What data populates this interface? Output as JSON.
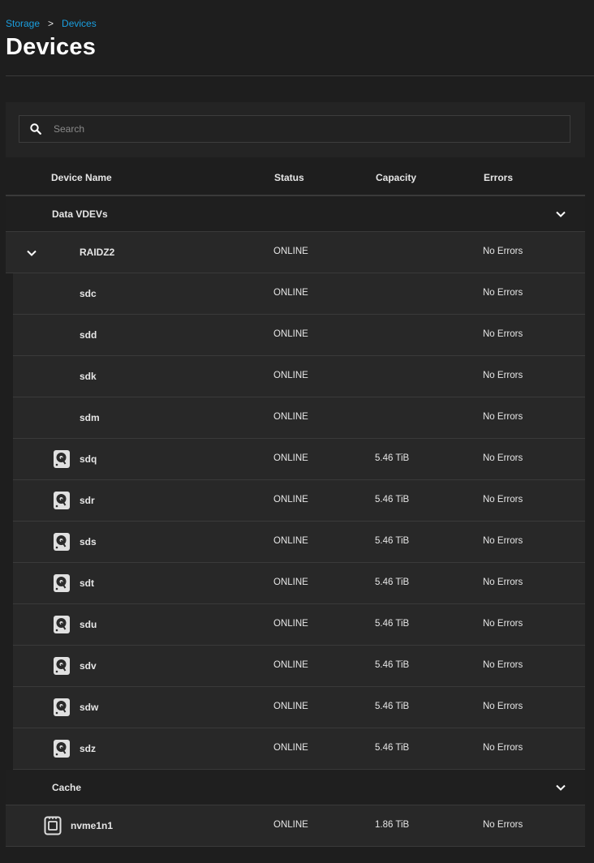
{
  "breadcrumb": {
    "items": [
      "Storage",
      "Devices"
    ],
    "separator": ">"
  },
  "page": {
    "title": "Devices"
  },
  "search": {
    "placeholder": "Search",
    "value": ""
  },
  "table": {
    "columns": [
      "Device Name",
      "Status",
      "Capacity",
      "Errors"
    ],
    "groups": [
      {
        "label": "Data VDEVs"
      },
      {
        "label": "Cache"
      }
    ],
    "vdev": {
      "name": "RAIDZ2",
      "status": "ONLINE",
      "capacity": "",
      "errors": "No Errors"
    },
    "data_rows": [
      {
        "name": "sdc",
        "status": "ONLINE",
        "capacity": "",
        "errors": "No Errors",
        "icon": ""
      },
      {
        "name": "sdd",
        "status": "ONLINE",
        "capacity": "",
        "errors": "No Errors",
        "icon": ""
      },
      {
        "name": "sdk",
        "status": "ONLINE",
        "capacity": "",
        "errors": "No Errors",
        "icon": ""
      },
      {
        "name": "sdm",
        "status": "ONLINE",
        "capacity": "",
        "errors": "No Errors",
        "icon": ""
      },
      {
        "name": "sdq",
        "status": "ONLINE",
        "capacity": "5.46 TiB",
        "errors": "No Errors",
        "icon": "hdd-icon"
      },
      {
        "name": "sdr",
        "status": "ONLINE",
        "capacity": "5.46 TiB",
        "errors": "No Errors",
        "icon": "hdd-icon"
      },
      {
        "name": "sds",
        "status": "ONLINE",
        "capacity": "5.46 TiB",
        "errors": "No Errors",
        "icon": "hdd-icon"
      },
      {
        "name": "sdt",
        "status": "ONLINE",
        "capacity": "5.46 TiB",
        "errors": "No Errors",
        "icon": "hdd-icon"
      },
      {
        "name": "sdu",
        "status": "ONLINE",
        "capacity": "5.46 TiB",
        "errors": "No Errors",
        "icon": "hdd-icon"
      },
      {
        "name": "sdv",
        "status": "ONLINE",
        "capacity": "5.46 TiB",
        "errors": "No Errors",
        "icon": "hdd-icon"
      },
      {
        "name": "sdw",
        "status": "ONLINE",
        "capacity": "5.46 TiB",
        "errors": "No Errors",
        "icon": "hdd-icon"
      },
      {
        "name": "sdz",
        "status": "ONLINE",
        "capacity": "5.46 TiB",
        "errors": "No Errors",
        "icon": "hdd-icon"
      }
    ],
    "cache_rows": [
      {
        "name": "nvme1n1",
        "status": "ONLINE",
        "capacity": "1.86 TiB",
        "errors": "No Errors",
        "icon": "ssd-icon"
      }
    ]
  },
  "colors": {
    "background": "#1e1e1e",
    "row": "#282828",
    "accent": "#1a9fe0",
    "text": "#e6e6e6"
  }
}
